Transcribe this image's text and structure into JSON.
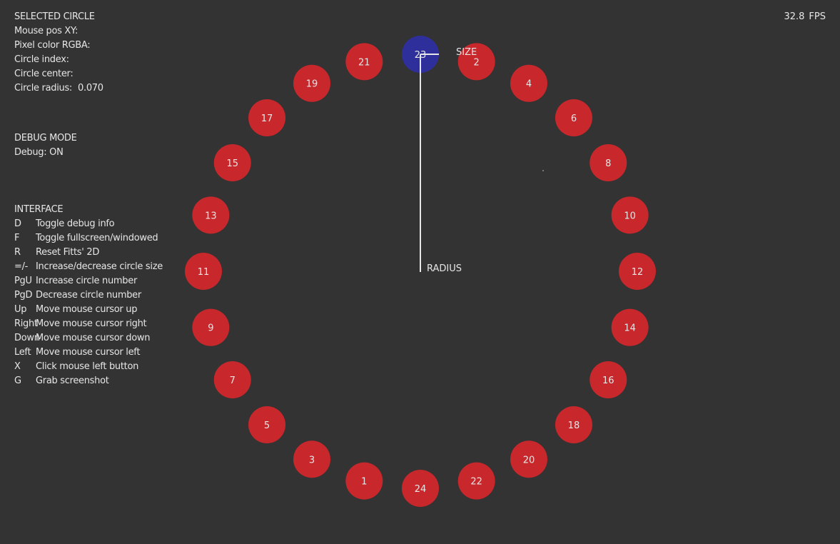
{
  "selected": {
    "heading": "SELECTED CIRCLE",
    "mouse_pos_label": "Mouse pos XY:",
    "pixel_color_label": "Pixel color RGBA:",
    "circle_index_label": "Circle index:",
    "circle_center_label": "Circle center:",
    "circle_radius_label": "Circle radius:",
    "circle_radius_value": "0.070"
  },
  "debug": {
    "heading": "DEBUG MODE",
    "status": "Debug: ON"
  },
  "interface": {
    "heading": "INTERFACE",
    "shortcuts": [
      {
        "key": "D",
        "action": "Toggle debug info"
      },
      {
        "key": "F",
        "action": "Toggle fullscreen/windowed"
      },
      {
        "key": "R",
        "action": "Reset Fitts' 2D"
      },
      {
        "key": "=/-",
        "action": "Increase/decrease circle size"
      },
      {
        "key": "PgU",
        "action": "Increase circle number"
      },
      {
        "key": "PgD",
        "action": "Decrease circle number"
      },
      {
        "key": "Up",
        "action": "Move mouse cursor up"
      },
      {
        "key": "Right",
        "action": "Move mouse cursor right"
      },
      {
        "key": "Down",
        "action": "Move mouse cursor down"
      },
      {
        "key": "Left",
        "action": "Move mouse cursor left"
      },
      {
        "key": "X",
        "action": "Click mouse left button"
      },
      {
        "key": "G",
        "action": "Grab screenshot"
      }
    ]
  },
  "fps": {
    "value": "32.8",
    "unit": "FPS"
  },
  "ring": {
    "labels_clockwise_from_top": [
      "23",
      "2",
      "4",
      "6",
      "8",
      "10",
      "12",
      "14",
      "16",
      "18",
      "20",
      "22",
      "24",
      "1",
      "3",
      "5",
      "7",
      "9",
      "11",
      "13",
      "15",
      "17",
      "19",
      "21"
    ],
    "selected_label": "23",
    "size_label": "SIZE",
    "radius_label": "RADIUS"
  },
  "colors": {
    "background": "#333333",
    "circle": "#c8282c",
    "selected_circle": "#2f2f9c",
    "text": "#e6e6e6",
    "guide_line": "#e6e6e6"
  }
}
